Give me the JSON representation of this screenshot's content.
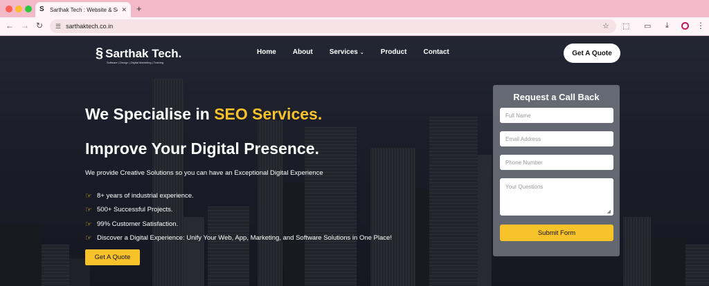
{
  "browser": {
    "tab_title": "Sarthak Tech : Website & Sof",
    "new_tab_label": "+",
    "url": "sarthaktech.co.in"
  },
  "site": {
    "logo_text": "Sarthak Tech.",
    "logo_tagline": "Software | Design | Digital Marketing | Training",
    "menu": [
      {
        "label": "Home"
      },
      {
        "label": "About"
      },
      {
        "label": "Services",
        "has_dropdown": true
      },
      {
        "label": "Product"
      },
      {
        "label": "Contact"
      }
    ],
    "header_button": "Get A Quote"
  },
  "hero": {
    "heading_prefix": "We Specialise in ",
    "heading_highlight": "SEO Services.",
    "heading2": "Improve Your Digital Presence.",
    "subtitle": "We provide Creative Solutions so you can have an Exceptional Digital Experience",
    "bullets": [
      "8+ years of industrial experience.",
      "500+ Successful Projects.",
      "99% Customer Satisfaction.",
      "Discover a Digital Experience: Unify Your Web, App, Marketing, and Software Solutions in One Place!"
    ],
    "cta": "Get A Quote",
    "highlight_color": "#f8c22b"
  },
  "form": {
    "title": "Request a Call Back",
    "name_placeholder": "Full Name",
    "email_placeholder": "Email Address",
    "phone_placeholder": "Phone Number",
    "questions_placeholder": "Your Questions",
    "submit_label": "Submit Form"
  }
}
